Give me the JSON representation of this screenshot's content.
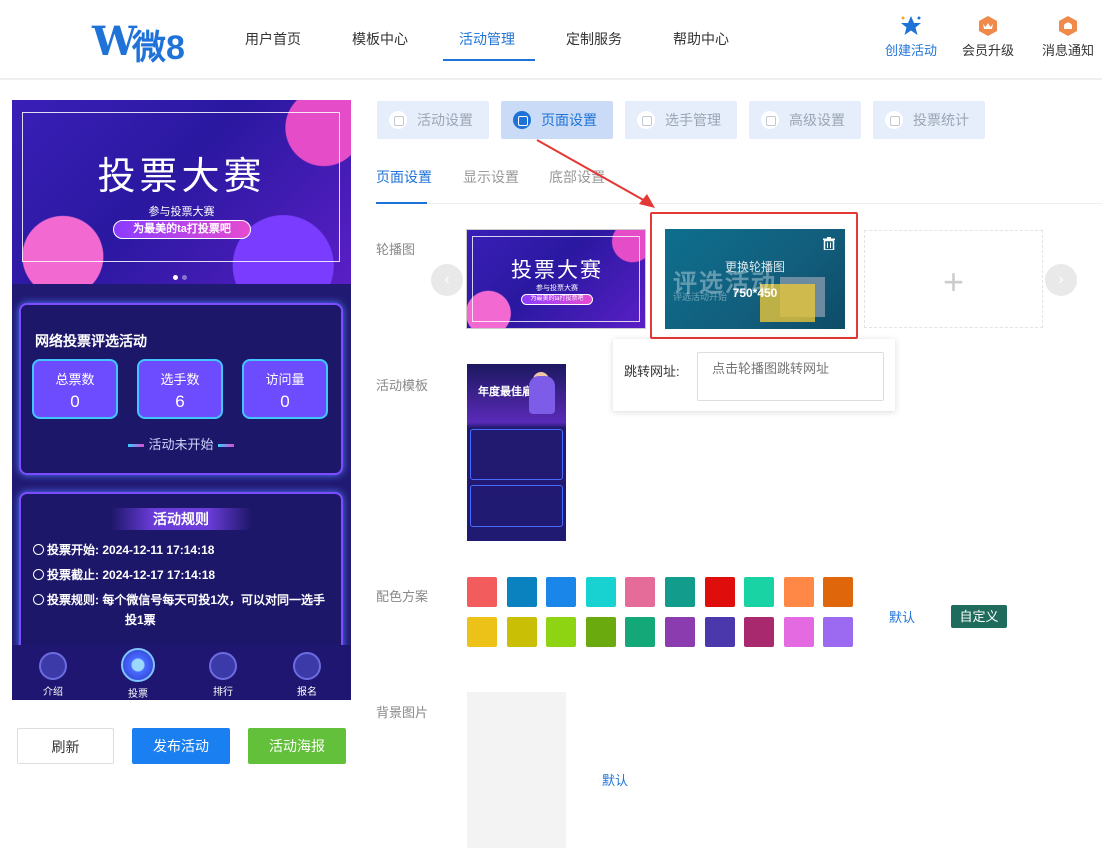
{
  "header": {
    "logo_w": "W",
    "logo_text": "微8",
    "nav": [
      "用户首页",
      "模板中心",
      "活动管理",
      "定制服务",
      "帮助中心"
    ],
    "actions": [
      {
        "label": "创建活动",
        "icon": "star-icon"
      },
      {
        "label": "会员升级",
        "icon": "crown-badge-icon"
      },
      {
        "label": "消息通知",
        "icon": "bell-badge-icon"
      }
    ]
  },
  "preview": {
    "banner_title": "投票大赛",
    "banner_sub": "参与投票大赛",
    "banner_pill": "为最美的ta打投票吧",
    "activity_title": "网络投票评选活动",
    "stats": [
      {
        "label": "总票数",
        "value": "0"
      },
      {
        "label": "选手数",
        "value": "6"
      },
      {
        "label": "访问量",
        "value": "0"
      }
    ],
    "status": "活动未开始",
    "rules_title": "活动规则",
    "rules": [
      {
        "key": "投票开始:",
        "value": "2024-12-11 17:14:18"
      },
      {
        "key": "投票截止:",
        "value": "2024-12-17 17:14:18"
      },
      {
        "key": "投票规则:",
        "value": "每个微信号每天可投1次，可以对同一选手投1票"
      }
    ],
    "tabbar": [
      "介绍",
      "投票",
      "排行",
      "报名"
    ]
  },
  "buttons": {
    "refresh": "刷新",
    "publish": "发布活动",
    "poster": "活动海报"
  },
  "top_tabs": [
    "活动设置",
    "页面设置",
    "选手管理",
    "高级设置",
    "投票统计"
  ],
  "sub_tabs": [
    "页面设置",
    "显示设置",
    "底部设置"
  ],
  "labels": {
    "carousel": "轮播图",
    "template": "活动模板",
    "color_scheme": "配色方案",
    "bg_image": "背景图片"
  },
  "carousel": {
    "slide1_title": "投票大赛",
    "slide1_sub": "参与投票大赛",
    "slide1_pill": "为最美的ta打投票吧",
    "slide2_bg_title": "评选活动",
    "slide2_bg_sub": "评选活动开始",
    "slide2_change": "更换轮播图",
    "slide2_size": "750*450",
    "prev": "‹",
    "next": "›",
    "add": "+"
  },
  "jump": {
    "label": "跳转网址:",
    "placeholder": "点击轮播图跳转网址"
  },
  "template_thumb": {
    "title": "年度最佳雇主"
  },
  "color_scheme": {
    "colors": [
      "#f25c5c",
      "#0a82c0",
      "#1a86ea",
      "#18d2d2",
      "#e56b98",
      "#119c8c",
      "#e00d0d",
      "#19d3a4",
      "#ff8847",
      "#e0660c",
      "#ecc219",
      "#c9c005",
      "#8fd413",
      "#6aaa0e",
      "#14a878",
      "#8b3cae",
      "#4a38ac",
      "#a8296e",
      "#e36ae0",
      "#9b6af0"
    ],
    "default_label": "默认",
    "custom_label": "自定义"
  },
  "bg_image": {
    "default_label": "默认"
  }
}
